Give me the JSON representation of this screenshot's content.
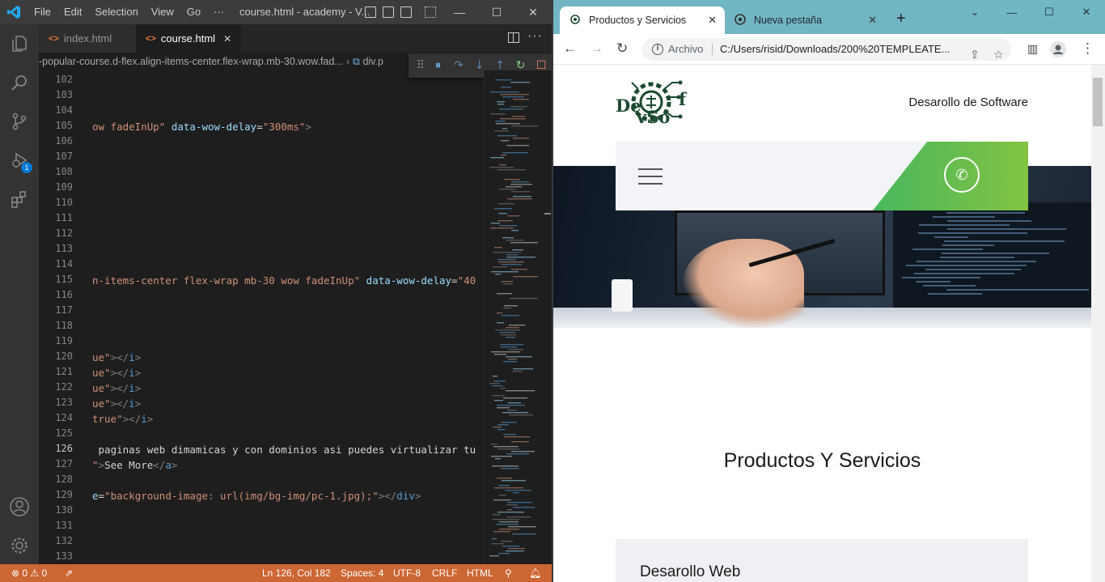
{
  "vscode": {
    "menu": [
      "File",
      "Edit",
      "Selection",
      "View",
      "Go",
      "···"
    ],
    "window_title": "course.html - academy - V...",
    "tabs": [
      {
        "label": "index.html"
      },
      {
        "label": "course.html"
      }
    ],
    "breadcrumb": {
      "path": "-popular-course.d-flex.align-items-center.flex-wrap.mb-30.wow.fad...",
      "tail": "div.p"
    },
    "activity_badge": "1",
    "line_numbers": [
      "102",
      "103",
      "104",
      "105",
      "106",
      "107",
      "108",
      "109",
      "110",
      "111",
      "112",
      "113",
      "114",
      "115",
      "116",
      "117",
      "118",
      "119",
      "120",
      "121",
      "122",
      "123",
      "124",
      "125",
      "126",
      "127",
      "128",
      "129",
      "130",
      "131",
      "132",
      "133"
    ],
    "current_line": "126",
    "code": {
      "l105_a": "ow fadeInUp\"",
      "l105_b": " data-wow-delay",
      "l105_c": "=",
      "l105_d": "\"300ms\"",
      "l105_e": ">",
      "l115_a": "n-items-center flex-wrap mb-30 wow fadeInUp\"",
      "l115_b": " data-wow-delay",
      "l115_c": "=",
      "l115_d": "\"40",
      "l120_a": "ue\"",
      "l120_b": "></",
      "l120_c": "i",
      "l120_d": ">",
      "l121_a": "ue\"",
      "l122_a": "ue\"",
      "l123_a": "ue\"",
      "l124_a": "true\"",
      "l126_a": " paginas web dimamicas y con dominios asi puedes virtualizar tu",
      "l127_a": "\"",
      "l127_b": ">",
      "l127_c": "See More",
      "l127_d": "</",
      "l127_e": "a",
      "l127_f": ">",
      "l129_a": "e",
      "l129_b": "=",
      "l129_c": "\"background-image: url(img/bg-img/pc-1.jpg);\"",
      "l129_d": "></",
      "l129_e": "div",
      "l129_f": ">"
    },
    "status": {
      "problems": "⊗ 0 ⚠ 0",
      "position": "Ln 126, Col 182",
      "spaces": "Spaces: 4",
      "encoding": "UTF-8",
      "eol": "CRLF",
      "language": "HTML"
    }
  },
  "chrome": {
    "tabs": [
      {
        "title": "Productos y Servicios"
      },
      {
        "title": "Nueva pestaña"
      }
    ],
    "address": {
      "scheme": "Archivo",
      "url": "C:/Users/risid/Downloads/200%20TEMPLEATE..."
    },
    "page": {
      "logo_text_top": "De",
      "logo_text_f": "f",
      "logo_text_bottom": "vSo",
      "tagline": "Desarollo de Software",
      "section_title": "Productos Y Servicios",
      "card_title": "Desarollo Web"
    }
  }
}
